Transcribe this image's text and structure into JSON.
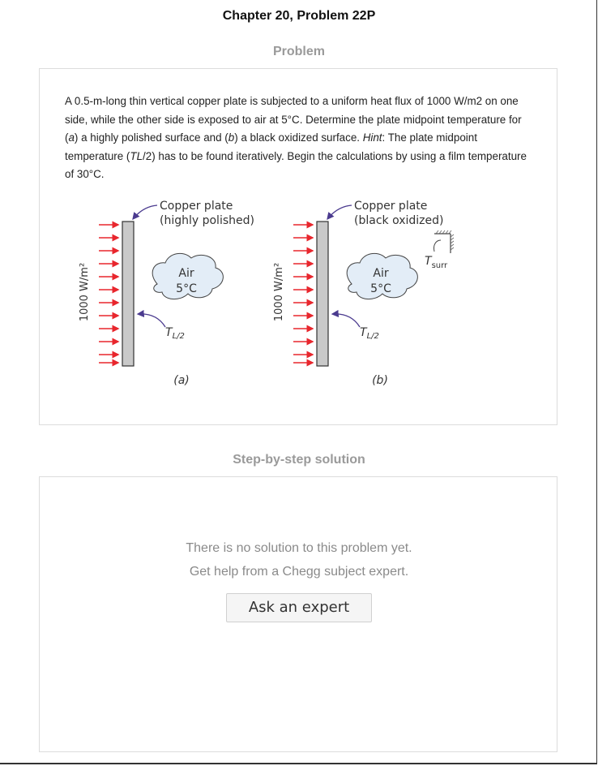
{
  "header": {
    "chapter_title": "Chapter 20, Problem 22P"
  },
  "problem_section": {
    "heading": "Problem",
    "text": {
      "p1": "A 0.5-m-long thin vertical copper plate is subjected to a uniform heat flux of 1000 W/m2 on one side, while the other side is exposed to air at 5°C. Determine the plate midpoint temperature for (",
      "a": "a",
      "p2": ") a highly polished surface and (",
      "b": "b",
      "p3": ") a black oxidized surface. ",
      "hint": "Hint",
      "p4": ": The plate midpoint temperature (",
      "tl2": "TL",
      "p5": "/2) has to be found iteratively. Begin the calculations by using a film temperature of 30°C."
    },
    "figure": {
      "left": {
        "plate_label_1": "Copper plate",
        "plate_label_2": "(highly polished)",
        "air_label": "Air",
        "air_temp": "5°C",
        "flux_label": "1000 W/m²",
        "t_label": "T",
        "t_sub": "L/2",
        "caption": "(a)"
      },
      "right": {
        "plate_label_1": "Copper plate",
        "plate_label_2": "(black oxidized)",
        "air_label": "Air",
        "air_temp": "5°C",
        "flux_label": "1000 W/m²",
        "t_label": "T",
        "t_sub": "L/2",
        "surr_label": "T",
        "surr_sub": "surr",
        "caption": "(b)"
      },
      "colors": {
        "arrow": "#e8262d",
        "plate": "#c9c9c9",
        "cloud": "#e3edf7",
        "pointer": "#4b3b8f"
      }
    }
  },
  "solution_section": {
    "heading": "Step-by-step solution",
    "empty_line_1": "There is no solution to this problem yet.",
    "empty_line_2": "Get help from a Chegg subject expert.",
    "ask_button": "Ask an expert"
  }
}
